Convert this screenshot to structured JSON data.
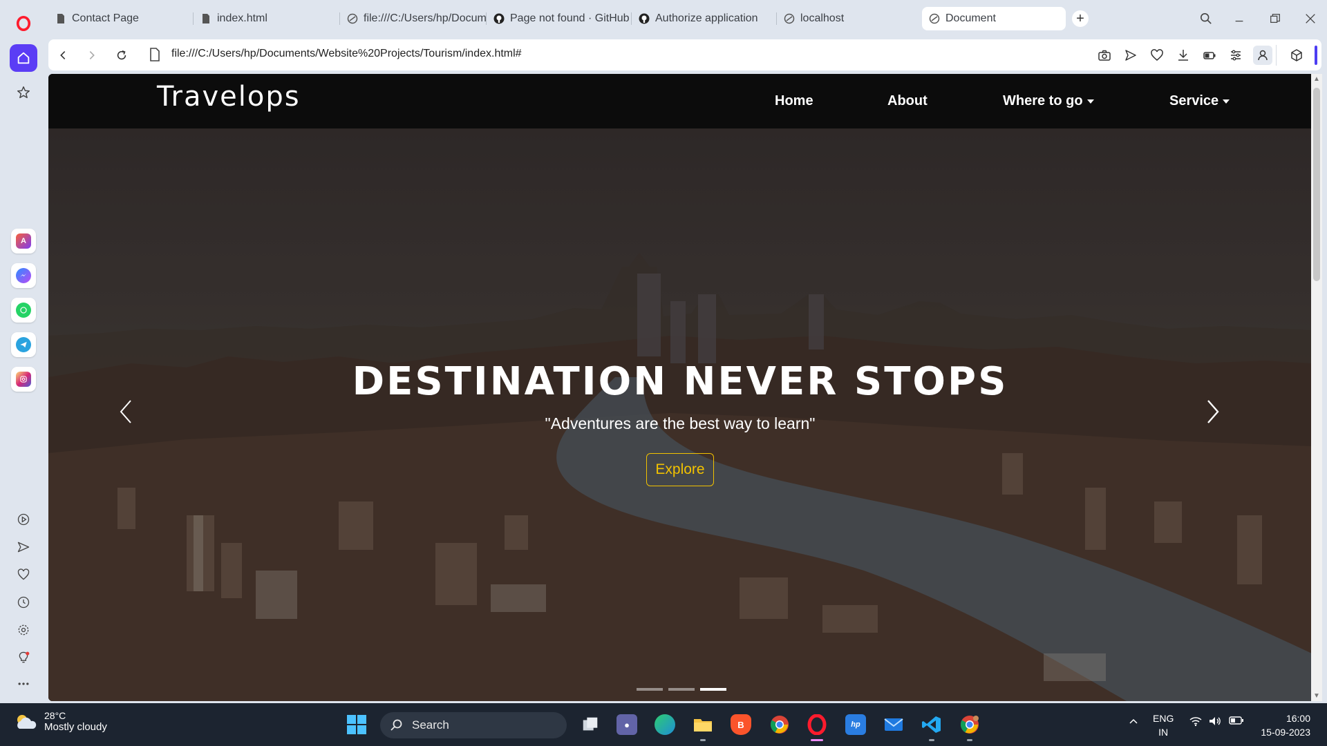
{
  "browser": {
    "tabs": [
      {
        "label": "Contact Page",
        "icon": "document-icon"
      },
      {
        "label": "index.html",
        "icon": "document-icon"
      },
      {
        "label": "file:///C:/Users/hp/Docum",
        "icon": "globe-icon"
      },
      {
        "label": "Page not found · GitHub",
        "icon": "github-icon"
      },
      {
        "label": "Authorize application",
        "icon": "github-icon"
      },
      {
        "label": "localhost",
        "icon": "globe-icon"
      },
      {
        "label": "Document",
        "icon": "globe-icon",
        "active": true
      }
    ],
    "new_tab_label": "+",
    "url": "file:///C:/Users/hp/Documents/Website%20Projects/Tourism/index.html#",
    "accent_color": "#4c3df2"
  },
  "site": {
    "brand": "Travelops",
    "nav": {
      "home": "Home",
      "about": "About",
      "where_to_go": "Where to go",
      "service": "Service"
    },
    "hero": {
      "headline": "DESTINATION NEVER STOPS",
      "subtitle": "\"Adventures are the best way to learn\"",
      "cta": "Explore",
      "cta_color": "#f2c200",
      "slides": 3,
      "active_slide": 3
    }
  },
  "taskbar": {
    "weather_temp": "28°C",
    "weather_text": "Mostly cloudy",
    "search_label": "Search",
    "lang_line1": "ENG",
    "lang_line2": "IN",
    "time": "16:00",
    "date": "15-09-2023"
  }
}
